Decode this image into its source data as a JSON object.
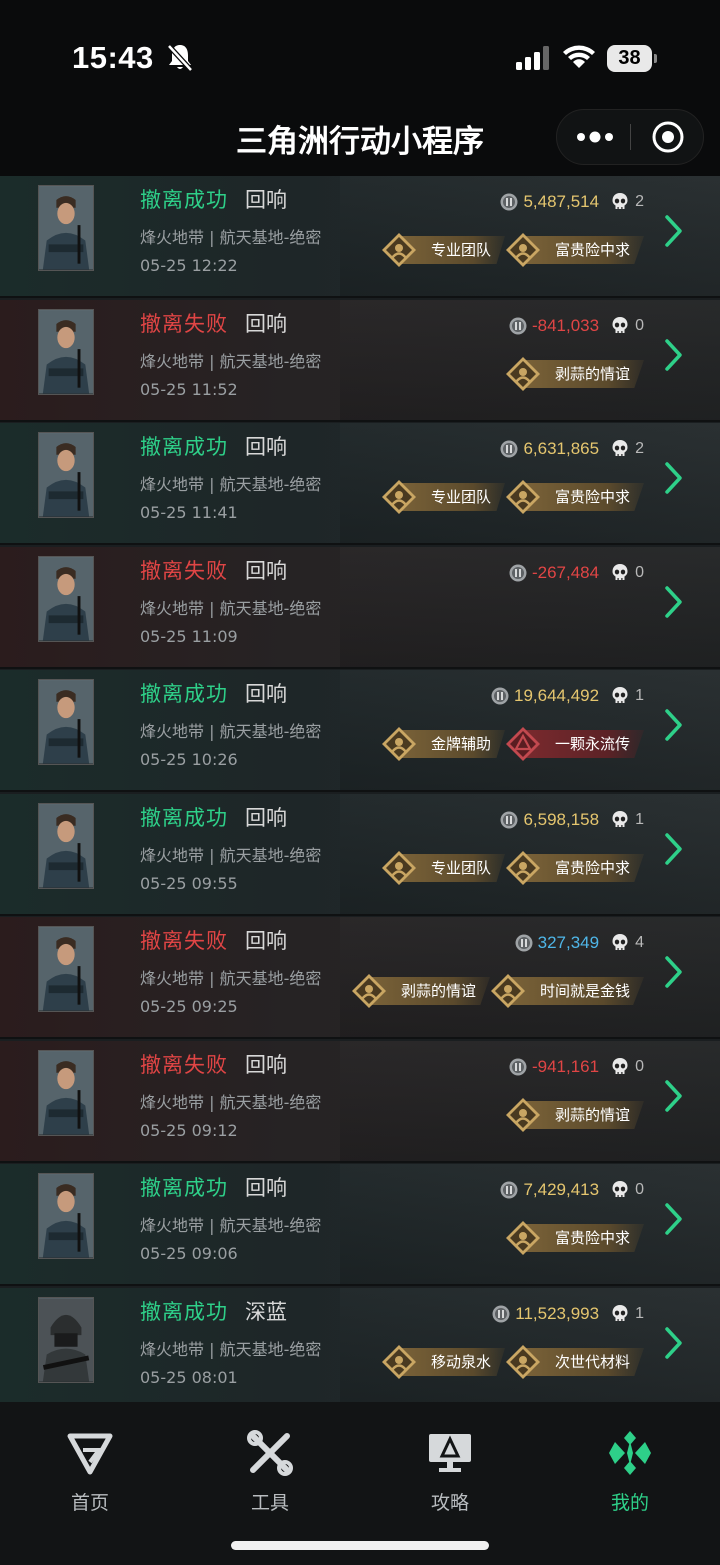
{
  "status_bar": {
    "time": "15:43",
    "battery": "38"
  },
  "nav": {
    "title": "三角洲行动小程序"
  },
  "records": [
    {
      "status": "撤离成功",
      "result": "success",
      "operator": "回响",
      "map": "烽火地带 | 航天基地-绝密",
      "time": "05-25 12:22",
      "value": "5,487,514",
      "value_color": "gold",
      "kills": "2",
      "avatar": "soldier",
      "badges": [
        {
          "label": "专业团队",
          "style": "gold"
        },
        {
          "label": "富贵险中求",
          "style": "gold"
        }
      ]
    },
    {
      "status": "撤离失败",
      "result": "fail",
      "operator": "回响",
      "map": "烽火地带 | 航天基地-绝密",
      "time": "05-25 11:52",
      "value": "-841,033",
      "value_color": "red",
      "kills": "0",
      "avatar": "soldier",
      "badges": [
        {
          "label": "剥蒜的情谊",
          "style": "gold"
        }
      ]
    },
    {
      "status": "撤离成功",
      "result": "success",
      "operator": "回响",
      "map": "烽火地带 | 航天基地-绝密",
      "time": "05-25 11:41",
      "value": "6,631,865",
      "value_color": "gold",
      "kills": "2",
      "avatar": "soldier",
      "badges": [
        {
          "label": "专业团队",
          "style": "gold"
        },
        {
          "label": "富贵险中求",
          "style": "gold"
        }
      ]
    },
    {
      "status": "撤离失败",
      "result": "fail",
      "operator": "回响",
      "map": "烽火地带 | 航天基地-绝密",
      "time": "05-25 11:09",
      "value": "-267,484",
      "value_color": "red",
      "kills": "0",
      "avatar": "soldier",
      "badges": []
    },
    {
      "status": "撤离成功",
      "result": "success",
      "operator": "回响",
      "map": "烽火地带 | 航天基地-绝密",
      "time": "05-25 10:26",
      "value": "19,644,492",
      "value_color": "gold",
      "kills": "1",
      "avatar": "soldier",
      "badges": [
        {
          "label": "金牌辅助",
          "style": "gold"
        },
        {
          "label": "一颗永流传",
          "style": "red"
        }
      ]
    },
    {
      "status": "撤离成功",
      "result": "success",
      "operator": "回响",
      "map": "烽火地带 | 航天基地-绝密",
      "time": "05-25 09:55",
      "value": "6,598,158",
      "value_color": "gold",
      "kills": "1",
      "avatar": "soldier",
      "badges": [
        {
          "label": "专业团队",
          "style": "gold"
        },
        {
          "label": "富贵险中求",
          "style": "gold"
        }
      ]
    },
    {
      "status": "撤离失败",
      "result": "fail",
      "operator": "回响",
      "map": "烽火地带 | 航天基地-绝密",
      "time": "05-25 09:25",
      "value": "327,349",
      "value_color": "blue",
      "kills": "4",
      "avatar": "soldier",
      "badges": [
        {
          "label": "剥蒜的情谊",
          "style": "gold"
        },
        {
          "label": "时间就是金钱",
          "style": "gold"
        }
      ]
    },
    {
      "status": "撤离失败",
      "result": "fail",
      "operator": "回响",
      "map": "烽火地带 | 航天基地-绝密",
      "time": "05-25 09:12",
      "value": "-941,161",
      "value_color": "red",
      "kills": "0",
      "avatar": "soldier",
      "badges": [
        {
          "label": "剥蒜的情谊",
          "style": "gold"
        }
      ]
    },
    {
      "status": "撤离成功",
      "result": "success",
      "operator": "回响",
      "map": "烽火地带 | 航天基地-绝密",
      "time": "05-25 09:06",
      "value": "7,429,413",
      "value_color": "gold",
      "kills": "0",
      "avatar": "soldier",
      "badges": [
        {
          "label": "富贵险中求",
          "style": "gold"
        }
      ]
    },
    {
      "status": "撤离成功",
      "result": "success",
      "operator": "深蓝",
      "map": "烽火地带 | 航天基地-绝密",
      "time": "05-25 08:01",
      "value": "11,523,993",
      "value_color": "gold",
      "kills": "1",
      "avatar": "helmet",
      "badges": [
        {
          "label": "移动泉水",
          "style": "gold"
        },
        {
          "label": "次世代材料",
          "style": "gold"
        }
      ]
    }
  ],
  "tabs": [
    {
      "label": "首页",
      "icon": "delta-logo-icon",
      "active": false
    },
    {
      "label": "工具",
      "icon": "tools-icon",
      "active": false
    },
    {
      "label": "攻略",
      "icon": "guide-monitor-icon",
      "active": false
    },
    {
      "label": "我的",
      "icon": "profile-diamond-icon",
      "active": true
    }
  ],
  "colors": {
    "success": "#2ed089",
    "fail": "#e04545",
    "gold": "#e5c66f",
    "blue": "#4fb6e8",
    "accent": "#2ed089"
  }
}
